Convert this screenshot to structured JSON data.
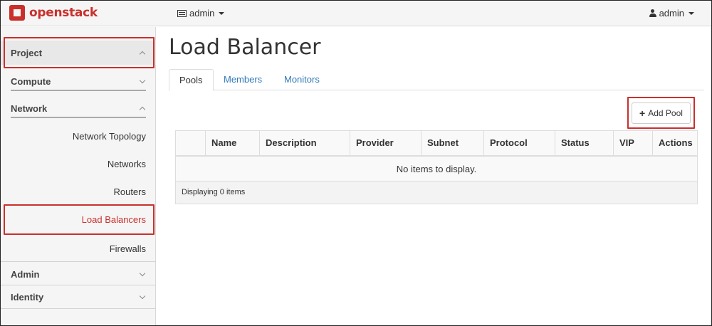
{
  "topbar": {
    "logo_text": "openstack",
    "project_label": "admin",
    "user_label": "admin"
  },
  "sidebar": {
    "project": "Project",
    "compute": "Compute",
    "network": "Network",
    "network_items": [
      "Network Topology",
      "Networks",
      "Routers",
      "Load Balancers",
      "Firewalls"
    ],
    "active_item": "Load Balancers",
    "admin": "Admin",
    "identity": "Identity"
  },
  "main": {
    "title": "Load Balancer",
    "tabs": [
      {
        "label": "Pools",
        "active": true
      },
      {
        "label": "Members",
        "active": false
      },
      {
        "label": "Monitors",
        "active": false
      }
    ],
    "add_button": "Add Pool",
    "table": {
      "columns": [
        "",
        "Name",
        "Description",
        "Provider",
        "Subnet",
        "Protocol",
        "Status",
        "VIP",
        "Actions"
      ],
      "empty_message": "No items to display.",
      "footer": "Displaying 0 items"
    }
  },
  "colors": {
    "accent_red": "#c9302c",
    "link_blue": "#337ab7"
  }
}
